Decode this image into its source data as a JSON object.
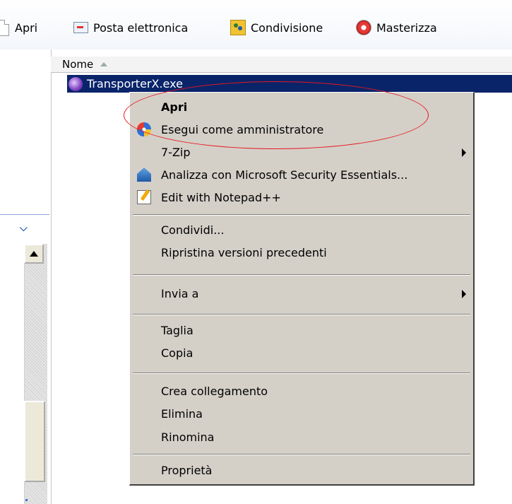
{
  "toolbar": {
    "open": "Apri",
    "email": "Posta elettronica",
    "share": "Condivisione",
    "burn": "Masterizza"
  },
  "file_list": {
    "column_name": "Nome",
    "selected_file": "TransporterX.exe"
  },
  "context_menu": {
    "items": [
      {
        "label": "Apri",
        "bold": true
      },
      {
        "label": "Esegui come amministratore",
        "icon": "uac-shield-icon"
      },
      {
        "label": "7-Zip",
        "submenu": true
      },
      {
        "label": "Analizza con Microsoft Security Essentials...",
        "icon": "security-essentials-icon"
      },
      {
        "label": "Edit with Notepad++",
        "icon": "notepad-plus-plus-icon"
      },
      {
        "label": "Condividi..."
      },
      {
        "label": "Ripristina versioni precedenti"
      },
      {
        "label": "Invia a",
        "submenu": true
      },
      {
        "label": "Taglia"
      },
      {
        "label": "Copia"
      },
      {
        "label": "Crea collegamento"
      },
      {
        "label": "Elimina"
      },
      {
        "label": "Rinomina"
      },
      {
        "label": "Proprietà"
      }
    ]
  },
  "colors": {
    "selection": "#0a246a",
    "menu_background": "#d4d0c8",
    "highlight_ellipse": "#e8171d"
  }
}
